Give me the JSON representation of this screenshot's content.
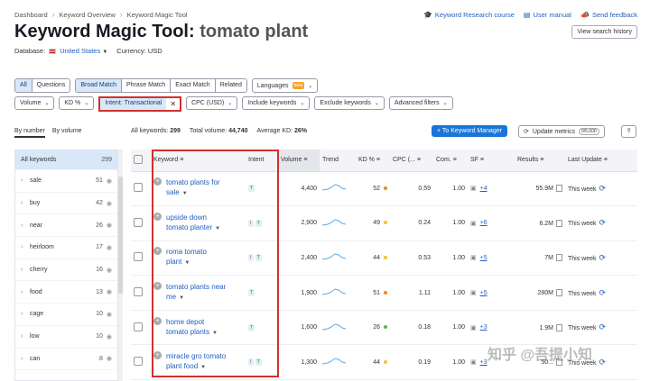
{
  "breadcrumb": [
    "Dashboard",
    "Keyword Overview",
    "Keyword Magic Tool"
  ],
  "top_links": [
    {
      "label": "Keyword Research course",
      "icon": "graduation-cap-icon"
    },
    {
      "label": "User manual",
      "icon": "book-icon"
    },
    {
      "label": "Send feedback",
      "icon": "megaphone-icon"
    }
  ],
  "title": {
    "prefix": "Keyword Magic Tool:",
    "keyword": "tomato plant"
  },
  "view_history": "View search history",
  "database": {
    "label": "Database:",
    "value": "United States",
    "currency": "Currency: USD"
  },
  "match_tabs": [
    "All",
    "Questions",
    "Broad Match",
    "Phrase Match",
    "Exact Match",
    "Related"
  ],
  "languages": {
    "label": "Languages",
    "badge": "beta"
  },
  "filters": {
    "volume": "Volume",
    "kd": "KD %",
    "intent": "Intent: Transactional",
    "cpc": "CPC (USD)",
    "include": "Include keywords",
    "exclude": "Exclude keywords",
    "advanced": "Advanced filters"
  },
  "group_tabs": [
    "By number",
    "By volume"
  ],
  "stats": {
    "all_label": "All keywords:",
    "all_value": "299",
    "vol_label": "Total volume:",
    "vol_value": "44,740",
    "kd_label": "Average KD:",
    "kd_value": "26%"
  },
  "to_keyword_manager": "+ To Keyword Manager",
  "update_metrics": {
    "label": "Update metrics",
    "count": "0/5,000"
  },
  "sidebar": [
    {
      "label": "All keywords",
      "count": "299"
    },
    {
      "label": "sale",
      "count": "51"
    },
    {
      "label": "buy",
      "count": "42"
    },
    {
      "label": "near",
      "count": "26"
    },
    {
      "label": "heirloom",
      "count": "17"
    },
    {
      "label": "cherry",
      "count": "16"
    },
    {
      "label": "food",
      "count": "13"
    },
    {
      "label": "cage",
      "count": "10"
    },
    {
      "label": "low",
      "count": "10"
    },
    {
      "label": "can",
      "count": "8"
    }
  ],
  "columns": [
    "Keyword",
    "Intent",
    "Volume",
    "Trend",
    "KD %",
    "CPC (...",
    "Com.",
    "SF",
    "Results",
    "Last Update"
  ],
  "rows": [
    {
      "kw1": "tomato plants for",
      "kw2": "sale",
      "intent": [
        "T"
      ],
      "volume": "4,400",
      "kd": "52",
      "kd_color": "#e98a2b",
      "cpc": "0.59",
      "com": "1.00",
      "sf": "+4",
      "results": "55.9M",
      "update": "This week"
    },
    {
      "kw1": "upside down",
      "kw2": "tomato planter",
      "intent": [
        "I",
        "T"
      ],
      "volume": "2,900",
      "kd": "49",
      "kd_color": "#f2c12e",
      "cpc": "0.24",
      "com": "1.00",
      "sf": "+6",
      "results": "6.2M",
      "update": "This week"
    },
    {
      "kw1": "roma tomato",
      "kw2": "plant",
      "intent": [
        "I",
        "T"
      ],
      "volume": "2,400",
      "kd": "44",
      "kd_color": "#f2c12e",
      "cpc": "0.53",
      "com": "1.00",
      "sf": "+5",
      "results": "7M",
      "update": "This week"
    },
    {
      "kw1": "tomato plants near",
      "kw2": "me",
      "intent": [
        "T"
      ],
      "volume": "1,900",
      "kd": "51",
      "kd_color": "#e98a2b",
      "cpc": "1.11",
      "com": "1.00",
      "sf": "+5",
      "results": "280M",
      "update": "This week"
    },
    {
      "kw1": "home depot",
      "kw2": "tomato plants",
      "intent": [
        "T"
      ],
      "volume": "1,600",
      "kd": "26",
      "kd_color": "#5bb35b",
      "cpc": "0.18",
      "com": "1.00",
      "sf": "+3",
      "results": "1.9M",
      "update": "This week"
    },
    {
      "kw1": "miracle gro tomato",
      "kw2": "plant food",
      "intent": [
        "I",
        "T"
      ],
      "volume": "1,300",
      "kd": "44",
      "kd_color": "#f2c12e",
      "cpc": "0.19",
      "com": "1.00",
      "sf": "+3",
      "results": "50...",
      "update": "This week"
    }
  ],
  "watermark": "知乎 @吾提小知"
}
